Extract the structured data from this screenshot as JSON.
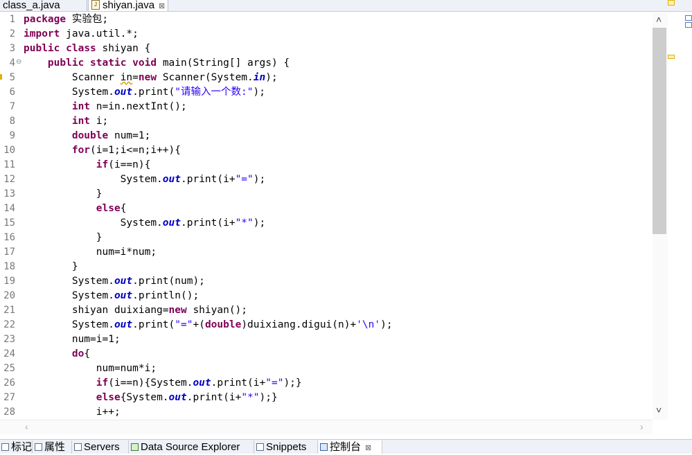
{
  "editor_tabs": [
    {
      "label": "class_a.java"
    },
    {
      "label": "shiyan.java",
      "close": "⊠"
    }
  ],
  "code_lines": [
    {
      "num": "1",
      "segs": [
        {
          "t": "package",
          "c": "kw"
        },
        {
          "t": " 实验包;"
        }
      ]
    },
    {
      "num": "2",
      "segs": [
        {
          "t": "import",
          "c": "kw"
        },
        {
          "t": " java.util.*;"
        }
      ]
    },
    {
      "num": "3",
      "segs": [
        {
          "t": "public",
          "c": "kw"
        },
        {
          "t": " "
        },
        {
          "t": "class",
          "c": "kw"
        },
        {
          "t": " shiyan {"
        }
      ]
    },
    {
      "num": "4",
      "fold": true,
      "segs": [
        {
          "t": "    "
        },
        {
          "t": "public",
          "c": "kw"
        },
        {
          "t": " "
        },
        {
          "t": "static",
          "c": "kw"
        },
        {
          "t": " "
        },
        {
          "t": "void",
          "c": "kw"
        },
        {
          "t": " main(String[] args) {"
        }
      ]
    },
    {
      "num": "5",
      "warn": true,
      "segs": [
        {
          "t": "        Scanner "
        },
        {
          "t": "in",
          "c": "warn"
        },
        {
          "t": "="
        },
        {
          "t": "new",
          "c": "kw"
        },
        {
          "t": " Scanner(System."
        },
        {
          "t": "in",
          "c": "fld"
        },
        {
          "t": ");"
        }
      ]
    },
    {
      "num": "6",
      "segs": [
        {
          "t": "        System."
        },
        {
          "t": "out",
          "c": "fld"
        },
        {
          "t": ".print("
        },
        {
          "t": "\"请输入一个数:\"",
          "c": "str"
        },
        {
          "t": ");"
        }
      ]
    },
    {
      "num": "7",
      "segs": [
        {
          "t": "        "
        },
        {
          "t": "int",
          "c": "kw"
        },
        {
          "t": " n=in.nextInt();"
        }
      ]
    },
    {
      "num": "8",
      "segs": [
        {
          "t": "        "
        },
        {
          "t": "int",
          "c": "kw"
        },
        {
          "t": " i;"
        }
      ]
    },
    {
      "num": "9",
      "segs": [
        {
          "t": "        "
        },
        {
          "t": "double",
          "c": "kw"
        },
        {
          "t": " num=1;"
        }
      ]
    },
    {
      "num": "10",
      "segs": [
        {
          "t": "        "
        },
        {
          "t": "for",
          "c": "kw"
        },
        {
          "t": "(i=1;i<=n;i++){"
        }
      ]
    },
    {
      "num": "11",
      "segs": [
        {
          "t": "            "
        },
        {
          "t": "if",
          "c": "kw"
        },
        {
          "t": "(i==n){"
        }
      ]
    },
    {
      "num": "12",
      "segs": [
        {
          "t": "                System."
        },
        {
          "t": "out",
          "c": "fld"
        },
        {
          "t": ".print(i+"
        },
        {
          "t": "\"=\"",
          "c": "str"
        },
        {
          "t": ");"
        }
      ]
    },
    {
      "num": "13",
      "segs": [
        {
          "t": "            }"
        }
      ]
    },
    {
      "num": "14",
      "segs": [
        {
          "t": "            "
        },
        {
          "t": "else",
          "c": "kw"
        },
        {
          "t": "{"
        }
      ]
    },
    {
      "num": "15",
      "segs": [
        {
          "t": "                System."
        },
        {
          "t": "out",
          "c": "fld"
        },
        {
          "t": ".print(i+"
        },
        {
          "t": "\"*\"",
          "c": "str"
        },
        {
          "t": ");"
        }
      ]
    },
    {
      "num": "16",
      "segs": [
        {
          "t": "            }"
        }
      ]
    },
    {
      "num": "17",
      "segs": [
        {
          "t": "            num=i*num;"
        }
      ]
    },
    {
      "num": "18",
      "segs": [
        {
          "t": "        }"
        }
      ]
    },
    {
      "num": "19",
      "segs": [
        {
          "t": "        System."
        },
        {
          "t": "out",
          "c": "fld"
        },
        {
          "t": ".print(num);"
        }
      ]
    },
    {
      "num": "20",
      "segs": [
        {
          "t": "        System."
        },
        {
          "t": "out",
          "c": "fld"
        },
        {
          "t": ".println();"
        }
      ]
    },
    {
      "num": "21",
      "segs": [
        {
          "t": "        shiyan duixiang="
        },
        {
          "t": "new",
          "c": "kw"
        },
        {
          "t": " shiyan();"
        }
      ]
    },
    {
      "num": "22",
      "segs": [
        {
          "t": "        System."
        },
        {
          "t": "out",
          "c": "fld"
        },
        {
          "t": ".print("
        },
        {
          "t": "\"=\"",
          "c": "str"
        },
        {
          "t": "+("
        },
        {
          "t": "double",
          "c": "kw"
        },
        {
          "t": ")duixiang.digui(n)+"
        },
        {
          "t": "'\\n'",
          "c": "str"
        },
        {
          "t": ");"
        }
      ]
    },
    {
      "num": "23",
      "segs": [
        {
          "t": "        num=i=1;"
        }
      ]
    },
    {
      "num": "24",
      "segs": [
        {
          "t": "        "
        },
        {
          "t": "do",
          "c": "kw"
        },
        {
          "t": "{"
        }
      ]
    },
    {
      "num": "25",
      "segs": [
        {
          "t": "            num=num*i;"
        }
      ]
    },
    {
      "num": "26",
      "segs": [
        {
          "t": "            "
        },
        {
          "t": "if",
          "c": "kw"
        },
        {
          "t": "(i==n){System."
        },
        {
          "t": "out",
          "c": "fld"
        },
        {
          "t": ".print(i+"
        },
        {
          "t": "\"=\"",
          "c": "str"
        },
        {
          "t": ");}"
        }
      ]
    },
    {
      "num": "27",
      "segs": [
        {
          "t": "            "
        },
        {
          "t": "else",
          "c": "kw"
        },
        {
          "t": "{System."
        },
        {
          "t": "out",
          "c": "fld"
        },
        {
          "t": ".print(i+"
        },
        {
          "t": "\"*\"",
          "c": "str"
        },
        {
          "t": ");}"
        }
      ]
    },
    {
      "num": "28",
      "segs": [
        {
          "t": "            i++;"
        }
      ]
    }
  ],
  "scroll": {
    "up": "˄",
    "down": "˅",
    "left": "‹",
    "right": "›"
  },
  "view_tabs": [
    {
      "label": "标记",
      "icon": "markers-icon"
    },
    {
      "label": "属性",
      "icon": "properties-icon"
    },
    {
      "label": "Servers",
      "icon": "servers-icon"
    },
    {
      "label": "Data Source Explorer",
      "icon": "data-source-explorer-icon"
    },
    {
      "label": "Snippets",
      "icon": "snippets-icon"
    },
    {
      "label": "控制台",
      "icon": "console-icon",
      "active": true,
      "close": "⊠"
    }
  ],
  "colors": {
    "keyword": "#7f0055",
    "string": "#2a00ff",
    "field": "#0000c0",
    "line_number": "#777777"
  }
}
